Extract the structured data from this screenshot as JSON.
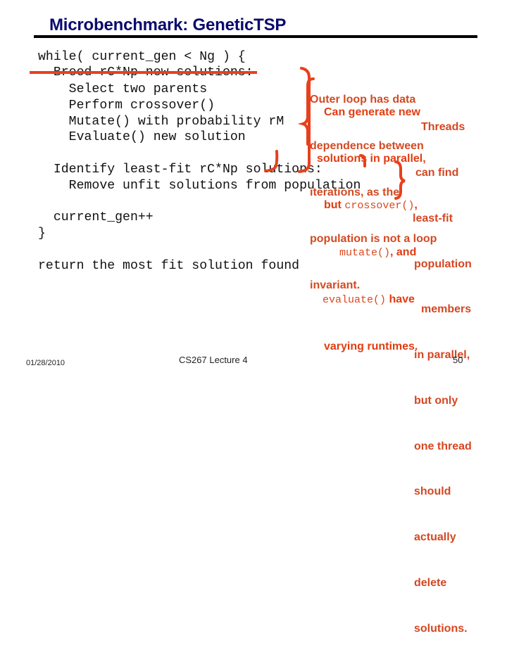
{
  "slide": {
    "title": "Microbenchmark: GeneticTSP",
    "code_lines": [
      "while( current_gen < Ng ) {",
      "  Breed rC*Np new solutions:",
      "    Select two parents",
      "    Perform crossover()",
      "    Mutate() with probability rM",
      "    Evaluate() new solution",
      "",
      "  Identify least-fit rC*Np solutions:",
      "    Remove unfit solutions from population",
      "",
      "  current_gen++",
      "}",
      "",
      "return the most fit solution found"
    ],
    "struck_line_index": 1,
    "annotations": {
      "outer_loop": {
        "lines": [
          "Outer loop has data",
          "dependence between",
          "iterations, as the",
          "population is not a loop",
          "invariant."
        ]
      },
      "generate": {
        "line1": "Can generate new",
        "line2": "solutions in parallel,",
        "line3_text": "but ",
        "line3_code": "crossover()",
        "line3_end": ",",
        "line4_code": "mutate()",
        "line4_text": ", and",
        "line5_code": "evaluate()",
        "line5_text": " have",
        "line6": "varying runtimes."
      },
      "threads": {
        "lines": [
          "Threads",
          "can find",
          "least-fit",
          "population",
          "members",
          "in parallel,",
          "but only",
          "one thread",
          "should",
          "actually",
          "delete",
          "solutions."
        ]
      }
    },
    "colors": {
      "title": "#0a0a6e",
      "annotation": "#d9481f",
      "strike": "#e8401c",
      "rule": "#000000"
    },
    "footer": {
      "date": "01/28/2010",
      "course": "CS267 Lecture 4",
      "page": "50"
    }
  }
}
